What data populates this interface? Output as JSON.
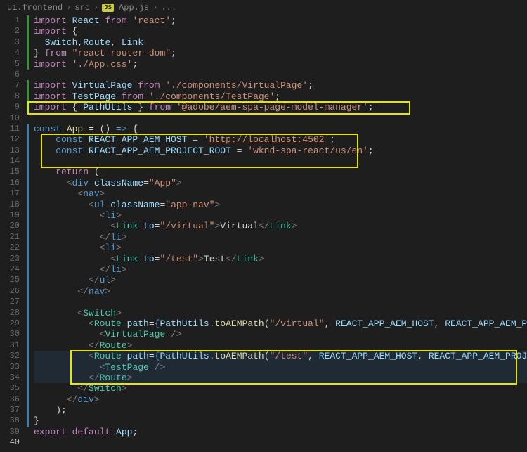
{
  "breadcrumb": {
    "p0": "ui.frontend",
    "p1": "src",
    "badge": "JS",
    "p2": "App.js",
    "p3": "..."
  },
  "code": {
    "l1": {
      "a": "import ",
      "b": "React ",
      "c": "from ",
      "d": "'react'",
      "e": ";"
    },
    "l2": {
      "a": "import ",
      "b": "{"
    },
    "l3": {
      "a": "  Switch",
      "b": ",",
      "c": "Route",
      "d": ", ",
      "e": "Link"
    },
    "l4": {
      "a": "} ",
      "b": "from ",
      "c": "\"react-router-dom\"",
      "d": ";"
    },
    "l5": {
      "a": "import ",
      "b": "'./App.css'",
      "c": ";"
    },
    "l7": {
      "a": "import ",
      "b": "VirtualPage ",
      "c": "from ",
      "d": "'./components/VirtualPage'",
      "e": ";"
    },
    "l8": {
      "a": "import ",
      "b": "TestPage ",
      "c": "from ",
      "d": "'./components/TestPage'",
      "e": ";"
    },
    "l9": {
      "a": "import ",
      "b": "{ ",
      "c": "PathUtils ",
      "d": "} ",
      "e": "from ",
      "f": "'@adobe/aem-spa-page-model-manager'",
      "g": ";"
    },
    "l11": {
      "a": "const ",
      "b": "App ",
      "c": "= () ",
      "d": "=> ",
      "e": "{"
    },
    "l12": {
      "a": "    const ",
      "b": "REACT_APP_AEM_HOST ",
      "c": "= ",
      "d": "'",
      "e": "http://localhost:4502",
      "f": "'",
      "g": ";"
    },
    "l13": {
      "a": "    const ",
      "b": "REACT_APP_AEM_PROJECT_ROOT ",
      "c": "= ",
      "d": "'wknd-spa-react/us/en'",
      "e": ";"
    },
    "l15": {
      "a": "    return ",
      "b": "("
    },
    "l16": {
      "a": "      ",
      "b": "<",
      "c": "div ",
      "d": "className",
      "e": "=",
      "f": "\"App\"",
      "g": ">"
    },
    "l17": {
      "a": "        ",
      "b": "<",
      "c": "nav",
      "d": ">"
    },
    "l18": {
      "a": "          ",
      "b": "<",
      "c": "ul ",
      "d": "className",
      "e": "=",
      "f": "\"app-nav\"",
      "g": ">"
    },
    "l19": {
      "a": "            ",
      "b": "<",
      "c": "li",
      "d": ">"
    },
    "l20": {
      "a": "              ",
      "b": "<",
      "c": "Link ",
      "d": "to",
      "e": "=",
      "f": "\"/virtual\"",
      "g": ">",
      "h": "Virtual",
      "i": "</",
      "j": "Link",
      "k": ">"
    },
    "l21": {
      "a": "            ",
      "b": "</",
      "c": "li",
      "d": ">"
    },
    "l22": {
      "a": "            ",
      "b": "<",
      "c": "li",
      "d": ">"
    },
    "l23": {
      "a": "              ",
      "b": "<",
      "c": "Link ",
      "d": "to",
      "e": "=",
      "f": "\"/test\"",
      "g": ">",
      "h": "Test",
      "i": "</",
      "j": "Link",
      "k": ">"
    },
    "l24": {
      "a": "            ",
      "b": "</",
      "c": "li",
      "d": ">"
    },
    "l25": {
      "a": "          ",
      "b": "</",
      "c": "ul",
      "d": ">"
    },
    "l26": {
      "a": "        ",
      "b": "</",
      "c": "nav",
      "d": ">"
    },
    "l28": {
      "a": "        ",
      "b": "<",
      "c": "Switch",
      "d": ">"
    },
    "l29": {
      "a": "          ",
      "b": "<",
      "c": "Route ",
      "d": "path",
      "e": "=",
      "f": "{",
      "g": "PathUtils",
      "h": ".",
      "i": "toAEMPath",
      "j": "(",
      "k": "\"/virtual\"",
      "l": ", ",
      "m": "REACT_APP_AEM_HOST",
      "n": ", ",
      "o": "REACT_APP_AEM_PROJECT_ROOT",
      "p": ")",
      "q": "}",
      "r": ">"
    },
    "l30": {
      "a": "            ",
      "b": "<",
      "c": "VirtualPage ",
      "d": "/>"
    },
    "l31": {
      "a": "          ",
      "b": "</",
      "c": "Route",
      "d": ">"
    },
    "l32": {
      "a": "          ",
      "b": "<",
      "c": "Route ",
      "d": "path",
      "e": "=",
      "f": "{",
      "g": "PathUtils",
      "h": ".",
      "i": "toAEMPath",
      "j": "(",
      "k": "\"/test\"",
      "l": ", ",
      "m": "REACT_APP_AEM_HOST",
      "n": ", ",
      "o": "REACT_APP_AEM_PROJECT_ROOT",
      "p": ")",
      "q": "}",
      "r": ">"
    },
    "l33": {
      "a": "            ",
      "b": "<",
      "c": "TestPage ",
      "d": "/>"
    },
    "l34": {
      "a": "          ",
      "b": "</",
      "c": "Route",
      "d": ">"
    },
    "l35": {
      "a": "        ",
      "b": "</",
      "c": "Switch",
      "d": ">"
    },
    "l36": {
      "a": "      ",
      "b": "</",
      "c": "div",
      "d": ">"
    },
    "l37": {
      "a": "    );"
    },
    "l38": {
      "a": "}"
    },
    "l39": {
      "a": "export default ",
      "b": "App",
      "c": ";"
    }
  }
}
